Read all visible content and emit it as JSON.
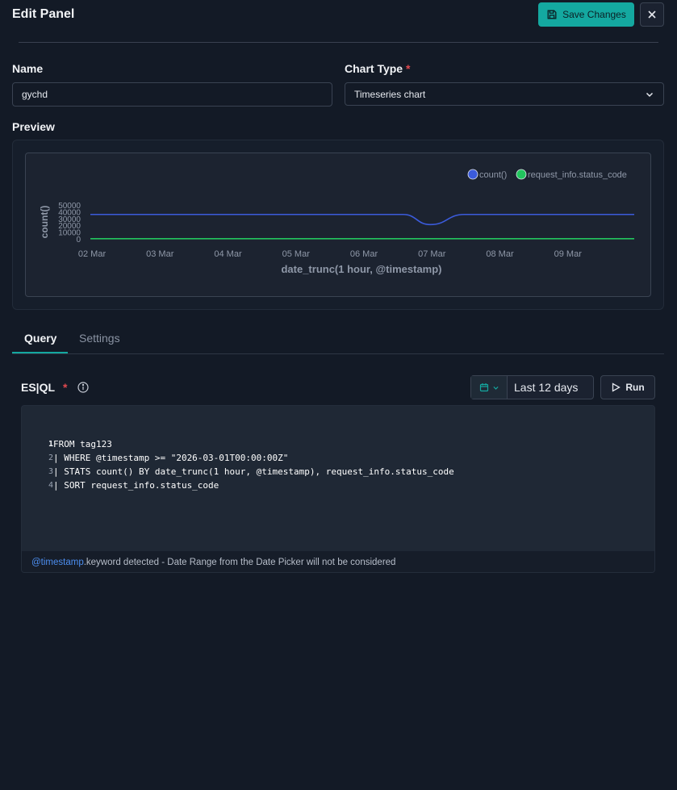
{
  "header": {
    "title": "Edit Panel",
    "save_label": "Save Changes"
  },
  "form": {
    "name_label": "Name",
    "name_value": "gychd",
    "chart_type_label": "Chart Type",
    "required_mark": "*",
    "chart_type_value": "Timeseries chart",
    "preview_label": "Preview"
  },
  "chart_data": {
    "type": "line",
    "x": [
      "02 Mar",
      "03 Mar",
      "04 Mar",
      "05 Mar",
      "06 Mar",
      "07 Mar",
      "08 Mar",
      "09 Mar"
    ],
    "series": [
      {
        "name": "count()",
        "color": "#3b5bdb",
        "points": [
          [
            2.0,
            36000
          ],
          [
            6.6,
            36000
          ],
          [
            7.0,
            21000
          ],
          [
            7.5,
            36000
          ],
          [
            10.0,
            36000
          ]
        ]
      },
      {
        "name": "request_info.status_code",
        "color": "#22c55e",
        "points": [
          [
            2.0,
            200
          ],
          [
            10.0,
            200
          ]
        ]
      }
    ],
    "yticks": [
      "50000",
      "40000",
      "30000",
      "20000",
      "10000",
      "0"
    ],
    "ylabel": "count()",
    "xlabel": "date_trunc(1 hour, @timestamp)",
    "ylim": [
      0,
      50000
    ],
    "xlim": [
      2,
      10
    ],
    "legend_position": "top-right",
    "grid": false
  },
  "tabs": [
    {
      "label": "Query",
      "active": true
    },
    {
      "label": "Settings",
      "active": false
    }
  ],
  "query": {
    "language_label": "ES|QL",
    "required_mark": "*",
    "date_range": "Last 12 days",
    "run_label": "Run",
    "lines": [
      {
        "num": "1",
        "text": "FROM tag123"
      },
      {
        "num": "2",
        "text": "| WHERE @timestamp >= \"2026-03-01T00:00:00Z\""
      },
      {
        "num": "3",
        "text": "| STATS count() BY date_trunc(1 hour, @timestamp), request_info.status_code"
      },
      {
        "num": "4",
        "text": "| SORT request_info.status_code"
      }
    ],
    "notice_keyword": "@timestamp",
    "notice_text": ".keyword detected - Date Range from the Date Picker will not be considered"
  },
  "colors": {
    "accent": "#14a8a0",
    "background": "#131a26",
    "required": "#e0494f",
    "link": "#4c8ef0"
  },
  "icons": {
    "save": "floppy-disk-icon",
    "close": "close-icon",
    "select": "chevron-down-icon",
    "info": "info-icon",
    "calendar": "calendar-icon",
    "run": "play-icon"
  }
}
